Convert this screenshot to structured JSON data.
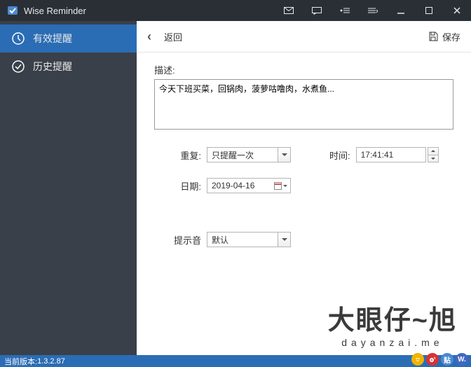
{
  "app": {
    "title": "Wise Reminder"
  },
  "sidebar": {
    "items": [
      {
        "label": "有效提醒"
      },
      {
        "label": "历史提醒"
      }
    ]
  },
  "toolbar": {
    "back_label": "返回",
    "save_label": "保存"
  },
  "form": {
    "desc_label": "描述:",
    "desc_value": "今天下班买菜，回锅肉，菠萝咕噜肉，水煮鱼...",
    "repeat_label": "重复:",
    "repeat_value": "只提醒一次",
    "time_label": "时间:",
    "time_value": "17:41:41",
    "date_label": "日期:",
    "date_value": "2019-04-16",
    "sound_label": "提示音",
    "sound_value": "默认"
  },
  "watermark": {
    "main": "大眼仔~旭",
    "sub": "dayanzai.me"
  },
  "status": {
    "version_label": "当前版本:",
    "version_value": "1.3.2.87"
  },
  "tray": {
    "c_text": "贴",
    "d_text": "W."
  }
}
